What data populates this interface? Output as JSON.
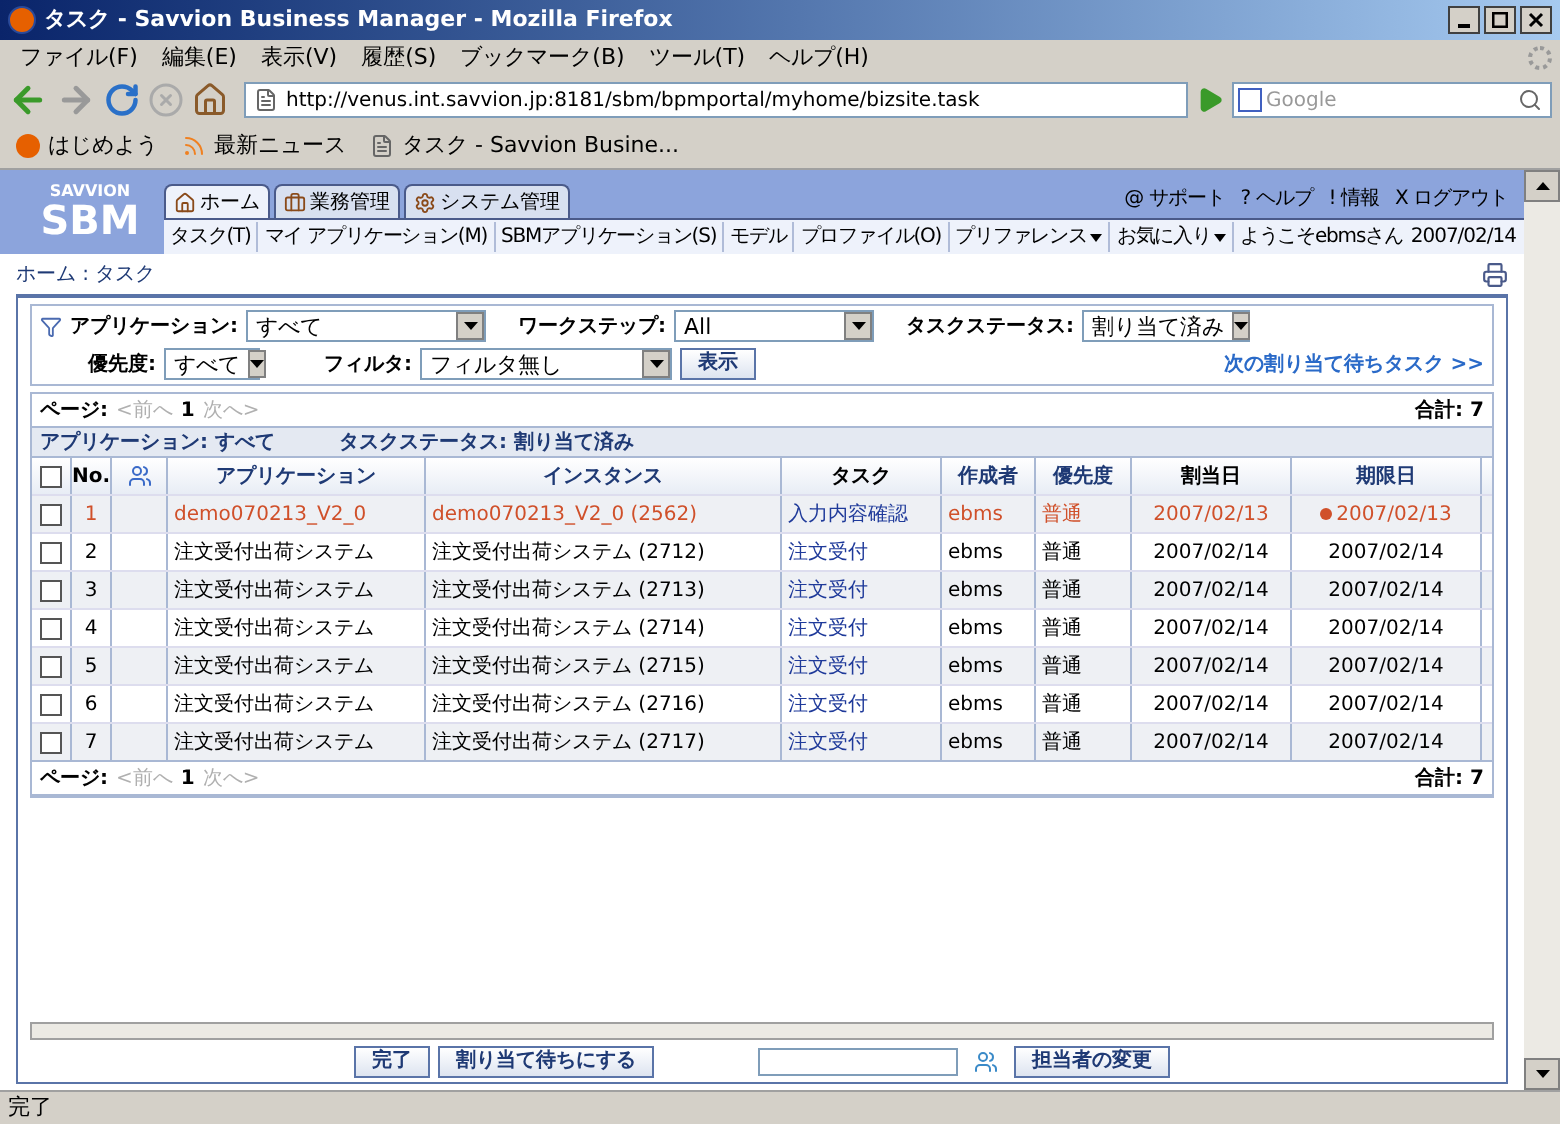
{
  "window": {
    "title": "タスク - Savvion Business Manager - Mozilla Firefox"
  },
  "menu_bar": [
    "ファイル(F)",
    "編集(E)",
    "表示(V)",
    "履歴(S)",
    "ブックマーク(B)",
    "ツール(T)",
    "ヘルプ(H)"
  ],
  "toolbar": {
    "url": "http://venus.int.savvion.jp:8181/sbm/bpmportal/myhome/bizsite.task",
    "search_placeholder": "Google"
  },
  "bookmarks": [
    "はじめよう",
    "最新ニュース",
    "タスク - Savvion Busine..."
  ],
  "app_header": {
    "logo_top": "SAVVION",
    "logo": "SBM",
    "tabs": [
      {
        "label": "ホーム",
        "selected": true
      },
      {
        "label": "業務管理",
        "selected": false
      },
      {
        "label": "システム管理",
        "selected": false
      }
    ],
    "top_links": [
      {
        "icon": "@",
        "label": "サポート"
      },
      {
        "icon": "?",
        "label": "ヘルプ"
      },
      {
        "icon": "!",
        "label": "情報"
      },
      {
        "icon": "X",
        "label": "ログアウト"
      }
    ],
    "subnav": [
      {
        "label": "タスク(T)",
        "dropdown": false
      },
      {
        "label": "マイ アプリケーション(M)",
        "dropdown": false
      },
      {
        "label": "SBMアプリケーション(S)",
        "dropdown": false
      },
      {
        "label": "モデル",
        "dropdown": false
      },
      {
        "label": "プロファイル(O)",
        "dropdown": false
      },
      {
        "label": "プリファレンス",
        "dropdown": true
      },
      {
        "label": "お気に入り",
        "dropdown": true
      }
    ],
    "welcome": "ようこそebmsさん",
    "date": "2007/02/14"
  },
  "breadcrumb": "ホーム : タスク",
  "filters": {
    "application_label": "アプリケーション:",
    "application": "すべて",
    "workstep_label": "ワークステップ:",
    "workstep": "All",
    "status_label": "タスクステータス:",
    "status": "割り当て済み",
    "priority_label": "優先度:",
    "priority": "すべて",
    "filter_label": "フィルタ:",
    "filter": "フィルタ無し",
    "show_button": "表示",
    "next_link": "次の割り当て待ちタスク >>"
  },
  "pager_top": {
    "label": "ページ:",
    "prev": "<前へ",
    "page": "1",
    "next": "次へ>",
    "total": "合計: 7"
  },
  "summary": {
    "application": "アプリケーション: すべて",
    "status": "タスクステータス: 割り当て済み"
  },
  "table": {
    "select_all_checked": false,
    "columns": [
      "No.",
      "アプリケーション",
      "インスタンス",
      "タスク",
      "作成者",
      "優先度",
      "割当日",
      "期限日"
    ],
    "rows": [
      {
        "no": "1",
        "application": "demo070213_V2_0",
        "instance": "demo070213_V2_0 (2562)",
        "task": "入力内容確認",
        "creator": "ebms",
        "priority": "普通",
        "assigned": "2007/02/13",
        "due": "2007/02/13",
        "overdue": true,
        "checked": false
      },
      {
        "no": "2",
        "application": "注文受付出荷システム",
        "instance": "注文受付出荷システム (2712)",
        "task": "注文受付",
        "creator": "ebms",
        "priority": "普通",
        "assigned": "2007/02/14",
        "due": "2007/02/14",
        "overdue": false,
        "checked": false
      },
      {
        "no": "3",
        "application": "注文受付出荷システム",
        "instance": "注文受付出荷システム (2713)",
        "task": "注文受付",
        "creator": "ebms",
        "priority": "普通",
        "assigned": "2007/02/14",
        "due": "2007/02/14",
        "overdue": false,
        "checked": false
      },
      {
        "no": "4",
        "application": "注文受付出荷システム",
        "instance": "注文受付出荷システム (2714)",
        "task": "注文受付",
        "creator": "ebms",
        "priority": "普通",
        "assigned": "2007/02/14",
        "due": "2007/02/14",
        "overdue": false,
        "checked": false
      },
      {
        "no": "5",
        "application": "注文受付出荷システム",
        "instance": "注文受付出荷システム (2715)",
        "task": "注文受付",
        "creator": "ebms",
        "priority": "普通",
        "assigned": "2007/02/14",
        "due": "2007/02/14",
        "overdue": false,
        "checked": false
      },
      {
        "no": "6",
        "application": "注文受付出荷システム",
        "instance": "注文受付出荷システム (2716)",
        "task": "注文受付",
        "creator": "ebms",
        "priority": "普通",
        "assigned": "2007/02/14",
        "due": "2007/02/14",
        "overdue": false,
        "checked": false
      },
      {
        "no": "7",
        "application": "注文受付出荷システム",
        "instance": "注文受付出荷システム (2717)",
        "task": "注文受付",
        "creator": "ebms",
        "priority": "普通",
        "assigned": "2007/02/14",
        "due": "2007/02/14",
        "overdue": false,
        "checked": false
      }
    ]
  },
  "pager_bottom": {
    "label": "ページ:",
    "prev": "<前へ",
    "page": "1",
    "next": "次へ>",
    "total": "合計: 7"
  },
  "actions": {
    "complete": "完了",
    "unassign": "割り当て待ちにする",
    "reassign": "担当者の変更"
  },
  "status_bar": "完了"
}
